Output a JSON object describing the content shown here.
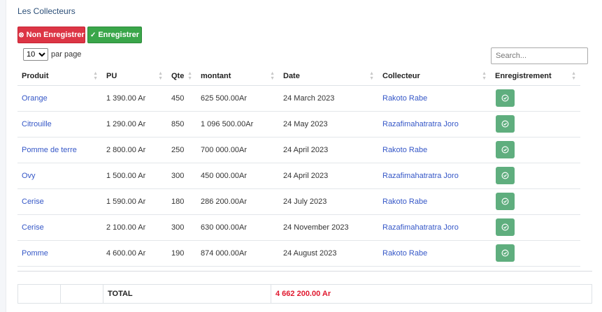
{
  "page": {
    "title": "Les Collecteurs"
  },
  "toolbar": {
    "non_enregistrer_label": "Non Enregistrer",
    "enregistrer_label": "Enregistrer"
  },
  "length": {
    "selected": "10",
    "options": [
      "10"
    ],
    "label": "par page"
  },
  "search": {
    "placeholder": "Search..."
  },
  "table": {
    "columns": [
      "Produit",
      "PU",
      "Qte",
      "montant",
      "Date",
      "Collecteur",
      "Enregistrement"
    ],
    "rows": [
      {
        "produit": "Orange",
        "pu": "1 390.00 Ar",
        "qte": "450",
        "montant": "625 500.00Ar",
        "date": "24 March 2023",
        "collecteur": "Rakoto Rabe"
      },
      {
        "produit": "Citrouille",
        "pu": "1 290.00 Ar",
        "qte": "850",
        "montant": "1 096 500.00Ar",
        "date": "24 May 2023",
        "collecteur": "Razafimahatratra Joro"
      },
      {
        "produit": "Pomme de terre",
        "pu": "2 800.00 Ar",
        "qte": "250",
        "montant": "700 000.00Ar",
        "date": "24 April 2023",
        "collecteur": "Rakoto Rabe"
      },
      {
        "produit": "Ovy",
        "pu": "1 500.00 Ar",
        "qte": "300",
        "montant": "450 000.00Ar",
        "date": "24 April 2023",
        "collecteur": "Razafimahatratra Joro"
      },
      {
        "produit": "Cerise",
        "pu": "1 590.00 Ar",
        "qte": "180",
        "montant": "286 200.00Ar",
        "date": "24 July 2023",
        "collecteur": "Rakoto Rabe"
      },
      {
        "produit": "Cerise",
        "pu": "2 100.00 Ar",
        "qte": "300",
        "montant": "630 000.00Ar",
        "date": "24 November 2023",
        "collecteur": "Razafimahatratra Joro"
      },
      {
        "produit": "Pomme",
        "pu": "4 600.00 Ar",
        "qte": "190",
        "montant": "874 000.00Ar",
        "date": "24 August 2023",
        "collecteur": "Rakoto Rabe"
      }
    ]
  },
  "footer": {
    "total_label": "TOTAL",
    "total_value": "4 662 200.00 Ar"
  }
}
